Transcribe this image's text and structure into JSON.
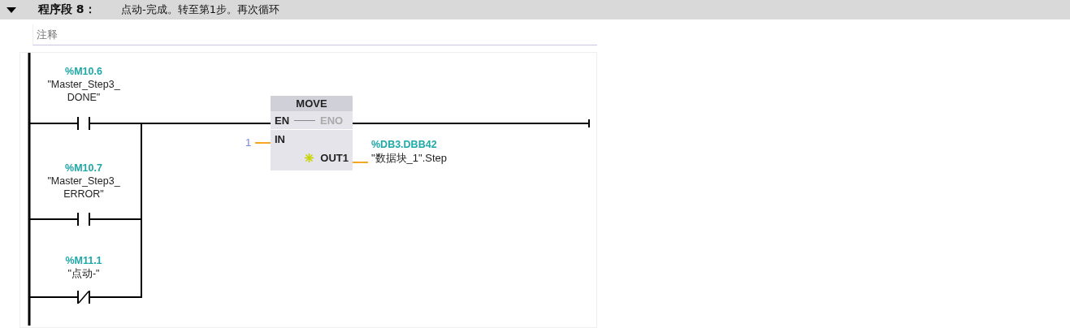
{
  "network": {
    "expanded": true,
    "label": "程序段 8：",
    "title": "点动-完成。转至第1步。再次循环"
  },
  "comment": {
    "placeholder": "注释"
  },
  "contacts": [
    {
      "kind": "no",
      "address": "%M10.6",
      "name": [
        "\"Master_Step3_",
        "DONE\""
      ]
    },
    {
      "kind": "no",
      "address": "%M10.7",
      "name": [
        "\"Master_Step3_",
        "ERROR\""
      ]
    },
    {
      "kind": "nc",
      "address": "%M11.1",
      "name": [
        "\"点动-\""
      ]
    }
  ],
  "block": {
    "type": "MOVE",
    "en": "EN",
    "eno": "ENO",
    "in_pin": "IN",
    "out_pin": "OUT1",
    "in_value": "1",
    "out_address": "%DB3.DBB42",
    "out_name": "\"数据块_1\".Step"
  }
}
